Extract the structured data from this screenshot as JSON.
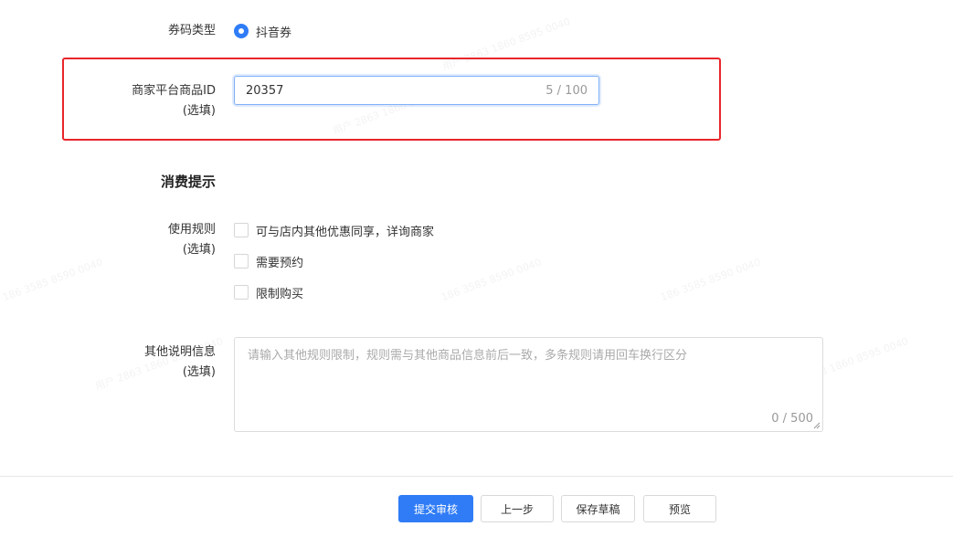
{
  "coupon_type": {
    "label": "券码类型",
    "option": "抖音券",
    "selected": true
  },
  "product_id": {
    "label": "商家平台商品ID",
    "optional": "(选填)",
    "value": "20357",
    "counter": "5 / 100"
  },
  "consumption_tips": {
    "title": "消费提示"
  },
  "usage_rules": {
    "label": "使用规则",
    "optional": "(选填)",
    "options": [
      {
        "label": "可与店内其他优惠同享，详询商家",
        "checked": false
      },
      {
        "label": "需要预约",
        "checked": false
      },
      {
        "label": "限制购买",
        "checked": false
      }
    ]
  },
  "other_info": {
    "label": "其他说明信息",
    "optional": "(选填)",
    "placeholder": "请输入其他规则限制，规则需与其他商品信息前后一致，多条规则请用回车换行区分",
    "counter": "0 / 500"
  },
  "footer": {
    "submit": "提交审核",
    "previous": "上一步",
    "save_draft": "保存草稿",
    "preview": "预览"
  },
  "colors": {
    "primary": "#2f7cf6",
    "highlight_border": "#e8262b"
  }
}
